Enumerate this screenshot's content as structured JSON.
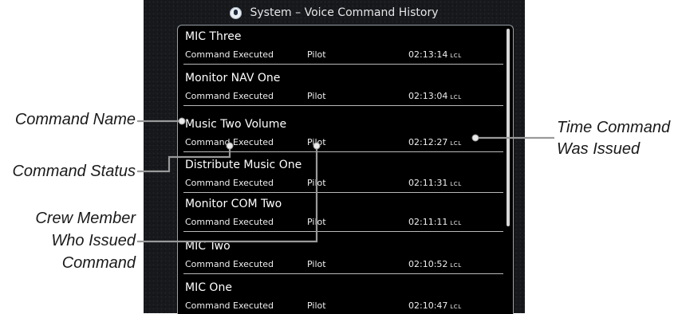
{
  "titlebar": {
    "icon": "voice-command-icon",
    "title": "System – Voice Command History"
  },
  "commands": [
    {
      "name": "MIC Three",
      "status": "Command Executed",
      "crew": "Pilot",
      "time": "02:13:14",
      "tz": "LCL"
    },
    {
      "name": "Monitor NAV One",
      "status": "Command Executed",
      "crew": "Pilot",
      "time": "02:13:04",
      "tz": "LCL"
    },
    {
      "name": "Music Two Volume",
      "status": "Command Executed",
      "crew": "Pilot",
      "time": "02:12:27",
      "tz": "LCL"
    },
    {
      "name": "Distribute Music One",
      "status": "Command Executed",
      "crew": "Pilot",
      "time": "02:11:31",
      "tz": "LCL"
    },
    {
      "name": "Monitor COM Two",
      "status": "Command Executed",
      "crew": "Pilot",
      "time": "02:11:11",
      "tz": "LCL"
    },
    {
      "name": "MIC Two",
      "status": "Command Executed",
      "crew": "Pilot",
      "time": "02:10:52",
      "tz": "LCL"
    },
    {
      "name": "MIC One",
      "status": "Command Executed",
      "crew": "Pilot",
      "time": "02:10:47",
      "tz": "LCL"
    }
  ],
  "callouts": {
    "command_name": "Command Name",
    "command_status": "Command Status",
    "crew_line1": "Crew Member",
    "crew_line2": "Who Issued",
    "crew_line3": "Command",
    "time_line1": "Time Command",
    "time_line2": "Was Issued"
  },
  "colors": {
    "screen_bg": "#16181c",
    "list_bg": "#000000",
    "callout_line": "#9a9a9a"
  }
}
